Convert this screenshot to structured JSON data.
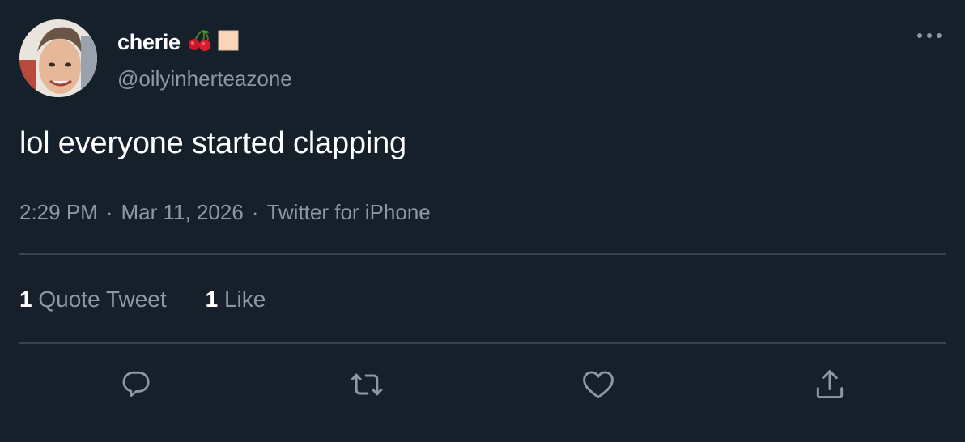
{
  "user": {
    "display_name": "cherie",
    "name_emojis": [
      "cherries-emoji",
      "skin-tone-square-emoji"
    ],
    "handle": "@oilyinherteazone",
    "avatar": "avatar"
  },
  "tweet": {
    "text": "lol everyone started clapping",
    "time": "2:29 PM",
    "separator": "·",
    "date": "Mar 11, 2026",
    "source": "Twitter for iPhone"
  },
  "stats": {
    "quote_count": "1",
    "quote_label": "Quote Tweet",
    "like_count": "1",
    "like_label": "Like"
  },
  "actions": [
    "reply-icon",
    "retweet-icon",
    "like-icon",
    "share-icon"
  ],
  "colors": {
    "background": "#15202b",
    "primary_text": "#ffffff",
    "secondary_text": "#8b98a5",
    "divider": "#38444d"
  }
}
